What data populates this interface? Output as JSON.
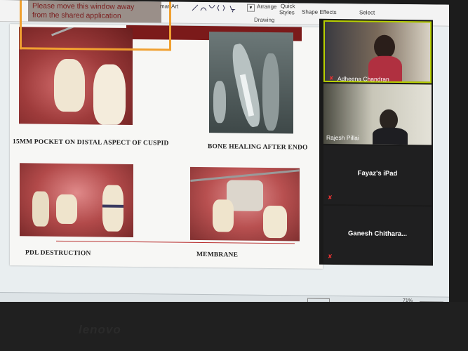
{
  "ribbon": {
    "smartart": "martArt",
    "arrange": "Arrange",
    "quick_styles_1": "Quick",
    "quick_styles_2": "Styles",
    "shape_effects": "Shape Effects",
    "select": "Select",
    "drawing_label": "Drawing"
  },
  "warning": {
    "line1": "Please move this window away",
    "line2": "from the shared application"
  },
  "slide": {
    "caption1": "15MM POCKET  ON DISTAL  ASPECT  OF CUSPID",
    "caption2": "BONE HEALING  AFTER  ENDO",
    "caption3": "PDL DESTRUCTION",
    "caption4": "MEMBRANE"
  },
  "participants": [
    {
      "name": "Adheena Chandran"
    },
    {
      "name": "Rajesh Pillai"
    },
    {
      "name": "Fayaz's iPad"
    },
    {
      "name": "Ganesh  Chithara..."
    }
  ],
  "status": {
    "zoom": "71%"
  },
  "bezel": {
    "logo": "lenovo"
  }
}
